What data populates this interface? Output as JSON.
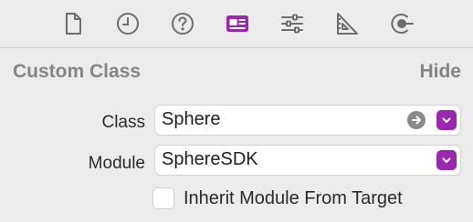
{
  "toolbar": {
    "icons": [
      "file-icon",
      "history-clock-icon",
      "help-question-icon",
      "identity-inspector-icon",
      "attributes-sliders-icon",
      "size-ruler-icon",
      "connections-icon"
    ],
    "active_icon": "identity-inspector-icon",
    "accent_color": "#9b27b0"
  },
  "section": {
    "title": "Custom Class",
    "hide_label": "Hide"
  },
  "fields": {
    "class_label": "Class",
    "class_value": "Sphere",
    "module_label": "Module",
    "module_value": "SphereSDK"
  },
  "inherit": {
    "label": "Inherit Module From Target",
    "checked": false
  }
}
